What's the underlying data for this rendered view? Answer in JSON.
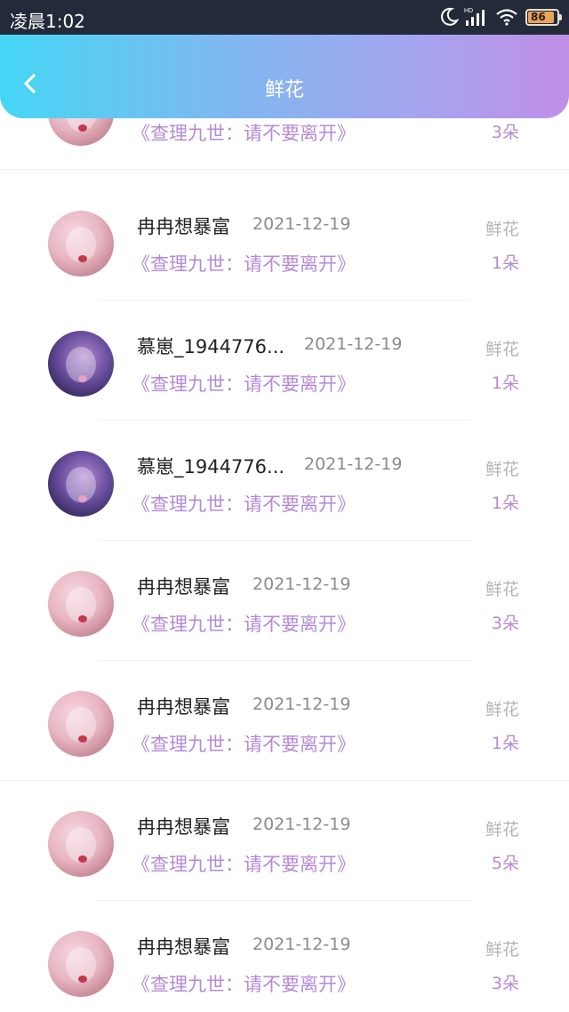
{
  "status_bar": {
    "time": "凌晨1:02",
    "battery": "86",
    "icons": [
      "moon-icon",
      "hd-signal-icon",
      "wifi-icon",
      "battery-icon"
    ]
  },
  "header": {
    "title": "鲜花",
    "back_icon": "chevron-left-icon"
  },
  "colors": {
    "header_gradient_start": "#45d6f5",
    "header_gradient_end": "#c08fe8",
    "accent_purple": "#b48ad8",
    "muted_gray": "#b5b5b5"
  },
  "gifts": [
    {
      "name": "",
      "date": "",
      "book": "《查理九世：请不要离开》",
      "kind": "",
      "count": "3朵"
    },
    {
      "name": "冉冉想暴富",
      "date": "2021-12-19",
      "book": "《查理九世：请不要离开》",
      "kind": "鲜花",
      "count": "1朵"
    },
    {
      "name": "慕崽_1944776...",
      "date": "2021-12-19",
      "book": "《查理九世：请不要离开》",
      "kind": "鲜花",
      "count": "1朵"
    },
    {
      "name": "慕崽_1944776...",
      "date": "2021-12-19",
      "book": "《查理九世：请不要离开》",
      "kind": "鲜花",
      "count": "1朵"
    },
    {
      "name": "冉冉想暴富",
      "date": "2021-12-19",
      "book": "《查理九世：请不要离开》",
      "kind": "鲜花",
      "count": "3朵"
    },
    {
      "name": "冉冉想暴富",
      "date": "2021-12-19",
      "book": "《查理九世：请不要离开》",
      "kind": "鲜花",
      "count": "1朵"
    },
    {
      "name": "冉冉想暴富",
      "date": "2021-12-19",
      "book": "《查理九世：请不要离开》",
      "kind": "鲜花",
      "count": "5朵"
    },
    {
      "name": "冉冉想暴富",
      "date": "2021-12-19",
      "book": "《查理九世：请不要离开》",
      "kind": "鲜花",
      "count": "3朵"
    }
  ]
}
